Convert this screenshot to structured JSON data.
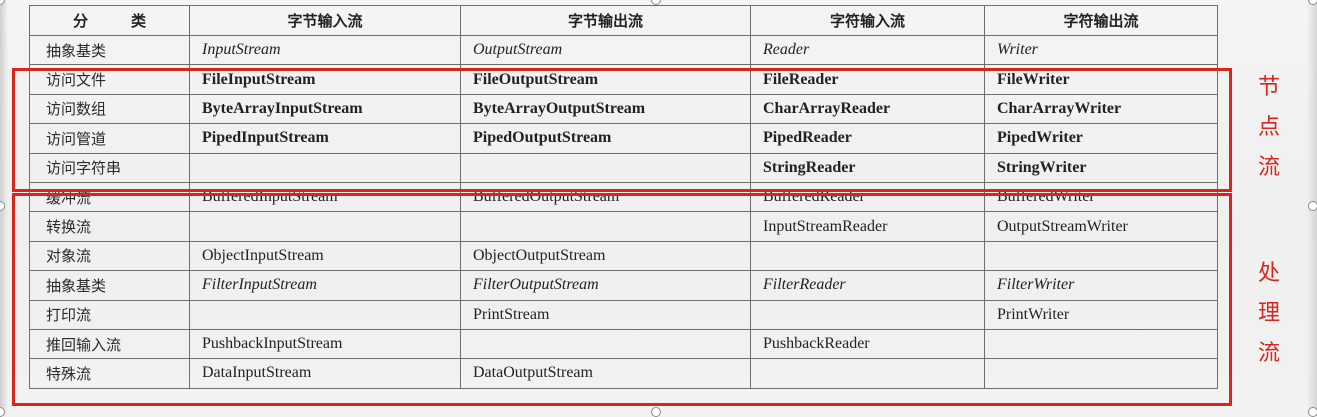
{
  "table": {
    "headers": [
      "分　类",
      "字节输入流",
      "字节输出流",
      "字符输入流",
      "字符输出流"
    ],
    "rows": [
      {
        "category": "抽象基类",
        "style": "italic",
        "cells": [
          "InputStream",
          "OutputStream",
          "Reader",
          "Writer"
        ]
      },
      {
        "category": "访问文件",
        "style": "bold",
        "cells": [
          "FileInputStream",
          "FileOutputStream",
          "FileReader",
          "FileWriter"
        ]
      },
      {
        "category": "访问数组",
        "style": "bold",
        "cells": [
          "ByteArrayInputStream",
          "ByteArrayOutputStream",
          "CharArrayReader",
          "CharArrayWriter"
        ]
      },
      {
        "category": "访问管道",
        "style": "bold",
        "cells": [
          "PipedInputStream",
          "PipedOutputStream",
          "PipedReader",
          "PipedWriter"
        ]
      },
      {
        "category": "访问字符串",
        "style": "bold",
        "cells": [
          "",
          "",
          "StringReader",
          "StringWriter"
        ]
      },
      {
        "category": "缓冲流",
        "style": "normal",
        "cells": [
          "BufferedInputStream",
          "BufferedOutputStream",
          "BufferedReader",
          "BufferedWriter"
        ]
      },
      {
        "category": "转换流",
        "style": "normal",
        "cells": [
          "",
          "",
          "InputStreamReader",
          "OutputStreamWriter"
        ]
      },
      {
        "category": "对象流",
        "style": "normal",
        "cells": [
          "ObjectInputStream",
          "ObjectOutputStream",
          "",
          ""
        ]
      },
      {
        "category": "抽象基类",
        "style": "italic",
        "cells": [
          "FilterInputStream",
          "FilterOutputStream",
          "FilterReader",
          "FilterWriter"
        ]
      },
      {
        "category": "打印流",
        "style": "normal",
        "cells": [
          "",
          "PrintStream",
          "",
          "PrintWriter"
        ]
      },
      {
        "category": "推回输入流",
        "style": "normal",
        "cells": [
          "PushbackInputStream",
          "",
          "PushbackReader",
          ""
        ]
      },
      {
        "category": "特殊流",
        "style": "normal",
        "cells": [
          "DataInputStream",
          "DataOutputStream",
          "",
          ""
        ]
      }
    ]
  },
  "annotations": {
    "node_stream": "节\n点\n流",
    "processing_stream": "处\n理\n流",
    "accent_color": "#d8261c"
  }
}
